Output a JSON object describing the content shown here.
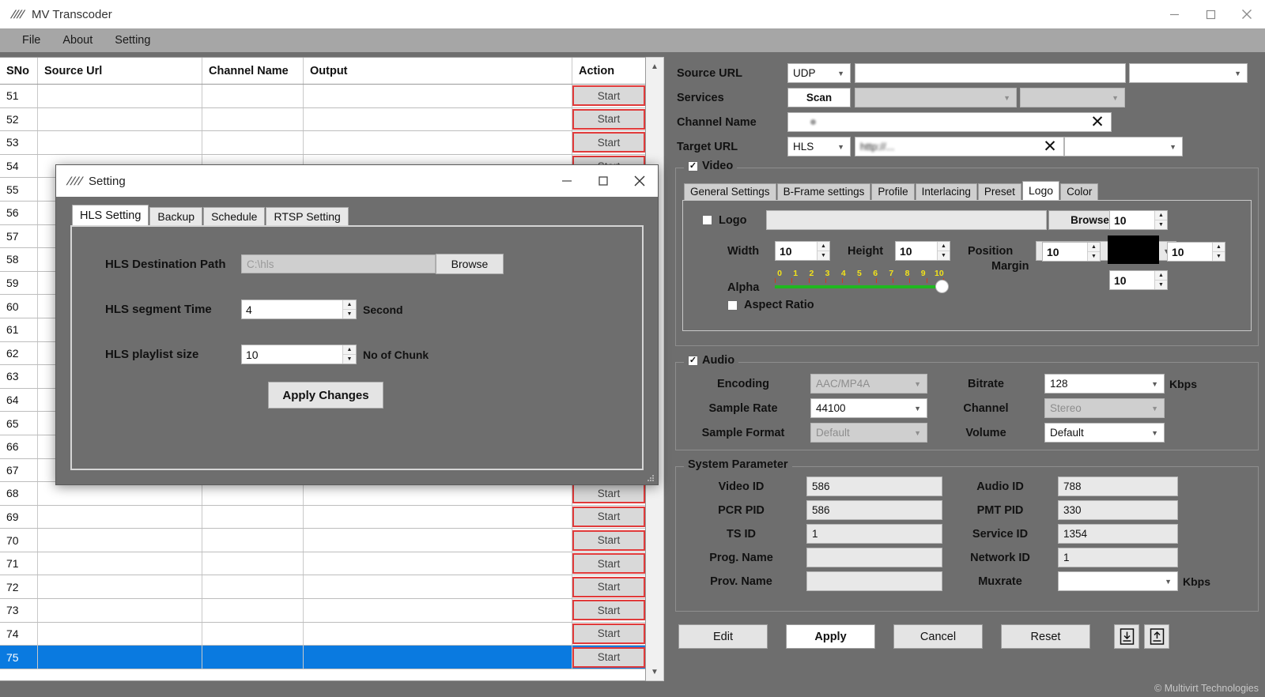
{
  "window": {
    "title": "MV Transcoder",
    "icon": "app-icon",
    "minimize": "—",
    "maximize": "□",
    "close": "✕"
  },
  "menubar": {
    "items": [
      {
        "label": "File"
      },
      {
        "label": "About"
      },
      {
        "label": "Setting"
      }
    ]
  },
  "grid": {
    "columns": [
      "SNo",
      "Source Url",
      "Channel Name",
      "Output",
      "Action"
    ],
    "action_label": "Start",
    "selected_row": "75",
    "rows": [
      {
        "sno": "51",
        "source": "",
        "channel": "",
        "output": ""
      },
      {
        "sno": "52",
        "source": "",
        "channel": "",
        "output": ""
      },
      {
        "sno": "53",
        "source": "",
        "channel": "",
        "output": ""
      },
      {
        "sno": "54",
        "source": "",
        "channel": "",
        "output": ""
      },
      {
        "sno": "55",
        "source": "",
        "channel": "",
        "output": ""
      },
      {
        "sno": "56",
        "source": "",
        "channel": "",
        "output": ""
      },
      {
        "sno": "57",
        "source": "",
        "channel": "",
        "output": ""
      },
      {
        "sno": "58",
        "source": "",
        "channel": "",
        "output": ""
      },
      {
        "sno": "59",
        "source": "",
        "channel": "",
        "output": ""
      },
      {
        "sno": "60",
        "source": "",
        "channel": "",
        "output": ""
      },
      {
        "sno": "61",
        "source": "",
        "channel": "",
        "output": ""
      },
      {
        "sno": "62",
        "source": "",
        "channel": "",
        "output": ""
      },
      {
        "sno": "63",
        "source": "",
        "channel": "",
        "output": ""
      },
      {
        "sno": "64",
        "source": "",
        "channel": "",
        "output": ""
      },
      {
        "sno": "65",
        "source": "",
        "channel": "",
        "output": ""
      },
      {
        "sno": "66",
        "source": "",
        "channel": "",
        "output": ""
      },
      {
        "sno": "67",
        "source": "",
        "channel": "",
        "output": ""
      },
      {
        "sno": "68",
        "source": "",
        "channel": "",
        "output": ""
      },
      {
        "sno": "69",
        "source": "",
        "channel": "",
        "output": ""
      },
      {
        "sno": "70",
        "source": "",
        "channel": "",
        "output": ""
      },
      {
        "sno": "71",
        "source": "",
        "channel": "",
        "output": ""
      },
      {
        "sno": "72",
        "source": "",
        "channel": "",
        "output": ""
      },
      {
        "sno": "73",
        "source": "",
        "channel": "",
        "output": ""
      },
      {
        "sno": "74",
        "source": "",
        "channel": "",
        "output": ""
      },
      {
        "sno": "75",
        "source": "",
        "channel": "",
        "output": ""
      }
    ]
  },
  "panel": {
    "source_url": {
      "label": "Source URL",
      "protocol": "UDP",
      "value": "",
      "extra": ""
    },
    "services": {
      "label": "Services",
      "scan_button": "Scan",
      "list1": "",
      "list2": ""
    },
    "channel_name": {
      "label": "Channel Name",
      "value": "",
      "clear": "✕"
    },
    "target_url": {
      "label": "Target URL",
      "protocol": "HLS",
      "value": "http://...",
      "clear": "✕",
      "extra": ""
    },
    "video": {
      "label": "Video",
      "checked": true,
      "tabs": [
        {
          "label": "General Settings",
          "active": false
        },
        {
          "label": "B-Frame settings",
          "active": false
        },
        {
          "label": "Profile",
          "active": false
        },
        {
          "label": "Interlacing",
          "active": false
        },
        {
          "label": "Preset",
          "active": false
        },
        {
          "label": "Logo",
          "active": true
        },
        {
          "label": "Color",
          "active": false
        }
      ],
      "logo_tab": {
        "logo_checkbox_label": "Logo",
        "logo_checked": false,
        "logo_path": "",
        "browse_label": "Browse",
        "width_label": "Width",
        "width_value": "10",
        "height_label": "Height",
        "height_value": "10",
        "position_label": "Position",
        "position_value": "",
        "alpha_label": "Alpha",
        "alpha_ticks": [
          "0",
          "1",
          "2",
          "3",
          "4",
          "5",
          "6",
          "7",
          "8",
          "9",
          "10"
        ],
        "alpha_value": 10,
        "aspect_ratio_label": "Aspect Ratio",
        "aspect_ratio_checked": false,
        "margin_label": "Margin",
        "margin_top": "10",
        "margin_left": "10",
        "margin_right": "10",
        "margin_bottom": "10",
        "preview_color": "#000000"
      }
    },
    "audio": {
      "label": "Audio",
      "checked": true,
      "encoding_label": "Encoding",
      "encoding_value": "AAC/MP4A",
      "bitrate_label": "Bitrate",
      "bitrate_value": "128",
      "bitrate_unit": "Kbps",
      "sample_rate_label": "Sample Rate",
      "sample_rate_value": "44100",
      "channel_label": "Channel",
      "channel_value": "Stereo",
      "sample_format_label": "Sample Format",
      "sample_format_value": "Default",
      "volume_label": "Volume",
      "volume_value": "Default"
    },
    "system_parameter": {
      "legend": "System Parameter",
      "video_id_label": "Video ID",
      "video_id_value": "586",
      "audio_id_label": "Audio ID",
      "audio_id_value": "788",
      "pcr_pid_label": "PCR PID",
      "pcr_pid_value": "586",
      "pmt_pid_label": "PMT PID",
      "pmt_pid_value": "330",
      "ts_id_label": "TS ID",
      "ts_id_value": "1",
      "service_id_label": "Service ID",
      "service_id_value": "1354",
      "prog_name_label": "Prog. Name",
      "prog_name_value": "",
      "network_id_label": "Network ID",
      "network_id_value": "1",
      "prov_name_label": "Prov. Name",
      "prov_name_value": "",
      "muxrate_label": "Muxrate",
      "muxrate_value": "",
      "muxrate_unit": "Kbps"
    },
    "actions": {
      "edit": "Edit",
      "apply": "Apply",
      "cancel": "Cancel",
      "reset": "Reset",
      "import_icon": "import-icon",
      "export_icon": "export-icon"
    },
    "copyright": "© Multivirt Technologies"
  },
  "setting_dialog": {
    "title": "Setting",
    "icon": "app-icon",
    "minimize": "—",
    "maximize": "□",
    "close": "✕",
    "tabs": [
      {
        "label": "HLS Setting",
        "active": true
      },
      {
        "label": "Backup",
        "active": false
      },
      {
        "label": "Schedule",
        "active": false
      },
      {
        "label": "RTSP Setting",
        "active": false
      }
    ],
    "dest_path_label": "HLS Destination Path",
    "dest_path_value": "C:\\hls",
    "browse_label": "Browse",
    "segment_time_label": "HLS segment Time",
    "segment_time_value": "4",
    "segment_time_unit": "Second",
    "playlist_size_label": "HLS playlist size",
    "playlist_size_value": "10",
    "playlist_size_unit": "No of Chunk",
    "apply_changes_label": "Apply Changes"
  },
  "colors": {
    "panel_bg": "#6e6e6e",
    "menubar_bg": "#a6a6a6",
    "accent_red": "#e03a3a",
    "selection_blue": "#0a7ae0",
    "alpha_track": "#1fb81f",
    "alpha_tick": "#f2e21a"
  }
}
